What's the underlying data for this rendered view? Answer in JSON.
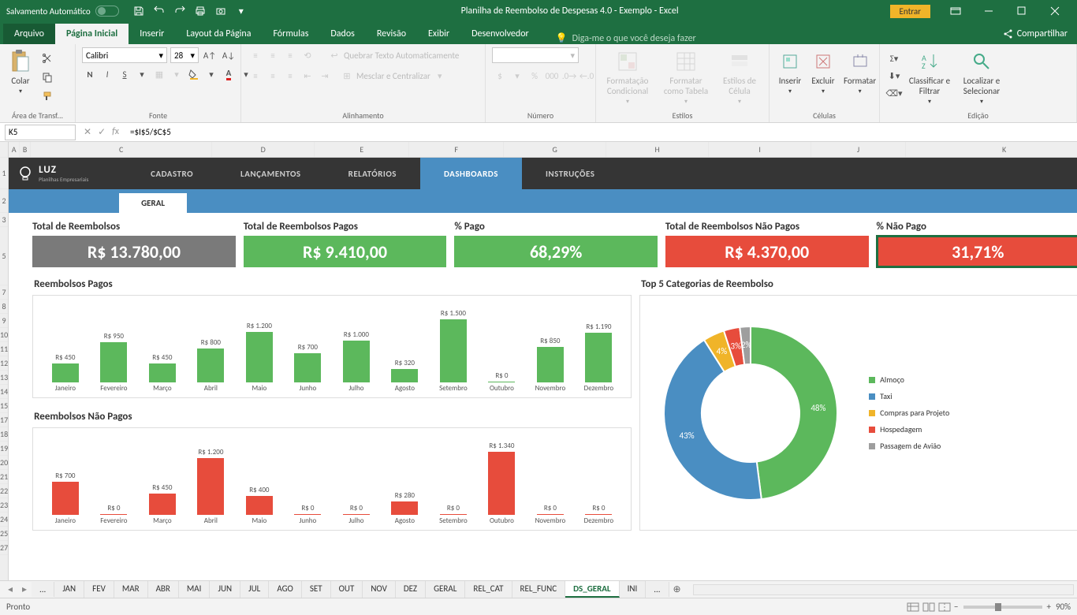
{
  "titlebar": {
    "autosave": "Salvamento Automático",
    "title": "Planilha de Reembolso de Despesas 4.0 - Exemplo  -  Excel",
    "signin": "Entrar"
  },
  "tabs": {
    "file": "Arquivo",
    "home": "Página Inicial",
    "insert": "Inserir",
    "layout": "Layout da Página",
    "formulas": "Fórmulas",
    "data": "Dados",
    "review": "Revisão",
    "view": "Exibir",
    "developer": "Desenvolvedor",
    "tellme": "Diga-me o que você deseja fazer",
    "share": "Compartilhar"
  },
  "ribbon": {
    "paste": "Colar",
    "clipboard_group": "Área de Transf...",
    "font": "Calibri",
    "fontsize": "28",
    "font_group": "Fonte",
    "wrap": "Quebrar Texto Automaticamente",
    "merge": "Mesclar e Centralizar",
    "align_group": "Alinhamento",
    "number_group": "Número",
    "conditional": "Formatação Condicional",
    "table": "Formatar como Tabela",
    "cellstyles": "Estilos de Célula",
    "styles_group": "Estilos",
    "insert_btn": "Inserir",
    "delete_btn": "Excluir",
    "format_btn": "Formatar",
    "cells_group": "Células",
    "sort": "Classificar e Filtrar",
    "find": "Localizar e Selecionar",
    "edit_group": "Edição"
  },
  "formula": {
    "cell": "K5",
    "value": "=$I$5/$C$5"
  },
  "columns": [
    "A",
    "B",
    "C",
    "D",
    "E",
    "F",
    "G",
    "H",
    "I",
    "J",
    "K"
  ],
  "rows": [
    "1",
    "2",
    "3",
    "5",
    "7",
    "8",
    "9",
    "10",
    "11",
    "12",
    "13",
    "14",
    "15",
    "17",
    "18",
    "19",
    "20",
    "21",
    "22",
    "23",
    "24",
    "25",
    "27"
  ],
  "dashnav": {
    "brand": "LUZ",
    "subtitle": "Planilhas Empresariais",
    "items": [
      "CADASTRO",
      "LANÇAMENTOS",
      "RELATÓRIOS",
      "DASHBOARDS",
      "INSTRUÇÕES"
    ],
    "active": "DASHBOARDS",
    "geral_tab": "GERAL"
  },
  "kpis": {
    "total_label": "Total de Reembolsos",
    "total_value": "R$ 13.780,00",
    "pago_label": "Total de Reembolsos Pagos",
    "pago_value": "R$ 9.410,00",
    "pct_pago_label": "% Pago",
    "pct_pago_value": "68,29%",
    "naopago_label": "Total de Reembolsos Não Pagos",
    "naopago_value": "R$ 4.370,00",
    "pct_naopago_label": "% Não Pago",
    "pct_naopago_value": "31,71%"
  },
  "chart_data": [
    {
      "type": "bar",
      "title": "Reembolsos Pagos",
      "categories": [
        "Janeiro",
        "Fevereiro",
        "Março",
        "Abril",
        "Maio",
        "Junho",
        "Julho",
        "Agosto",
        "Setembro",
        "Outubro",
        "Novembro",
        "Dezembro"
      ],
      "values": [
        450,
        950,
        450,
        800,
        1200,
        700,
        1000,
        320,
        1500,
        0,
        850,
        1190
      ],
      "value_labels": [
        "R$ 450",
        "R$ 950",
        "R$ 450",
        "R$ 800",
        "R$ 1.200",
        "R$ 700",
        "R$ 1.000",
        "R$ 320",
        "R$ 1.500",
        "R$ 0",
        "R$ 850",
        "R$ 1.190"
      ],
      "color": "#5cb85c",
      "ylim": [
        0,
        1500
      ]
    },
    {
      "type": "bar",
      "title": "Reembolsos Não Pagos",
      "categories": [
        "Janeiro",
        "Fevereiro",
        "Março",
        "Abril",
        "Maio",
        "Junho",
        "Julho",
        "Agosto",
        "Setembro",
        "Outubro",
        "Novembro",
        "Dezembro"
      ],
      "values": [
        700,
        0,
        450,
        1200,
        400,
        0,
        0,
        280,
        0,
        1340,
        0,
        0
      ],
      "value_labels": [
        "R$ 700",
        "R$ 0",
        "R$ 450",
        "R$ 1.200",
        "R$ 400",
        "R$ 0",
        "R$ 0",
        "R$ 280",
        "R$ 0",
        "R$ 1.340",
        "R$ 0",
        "R$ 0"
      ],
      "color": "#e74c3c",
      "ylim": [
        0,
        1340
      ]
    },
    {
      "type": "pie",
      "title": "Top 5 Categorias de Reembolso",
      "series": [
        {
          "name": "Almoço",
          "value": 48,
          "color": "#5cb85c"
        },
        {
          "name": "Taxi",
          "value": 43,
          "color": "#4a8ec2"
        },
        {
          "name": "Compras para Projeto",
          "value": 4,
          "color": "#f0b429"
        },
        {
          "name": "Hospedagem",
          "value": 3,
          "color": "#e74c3c"
        },
        {
          "name": "Passagem de Avião",
          "value": 2,
          "color": "#9e9e9e"
        }
      ]
    }
  ],
  "sheets": {
    "dots": "...",
    "list": [
      "JAN",
      "FEV",
      "MAR",
      "ABR",
      "MAI",
      "JUN",
      "JUL",
      "AGO",
      "SET",
      "OUT",
      "NOV",
      "DEZ",
      "GERAL",
      "REL_CAT",
      "REL_FUNC",
      "DS_GERAL",
      "INI"
    ],
    "active": "DS_GERAL",
    "dots2": "..."
  },
  "status": {
    "ready": "Pronto",
    "zoom": "90%"
  }
}
